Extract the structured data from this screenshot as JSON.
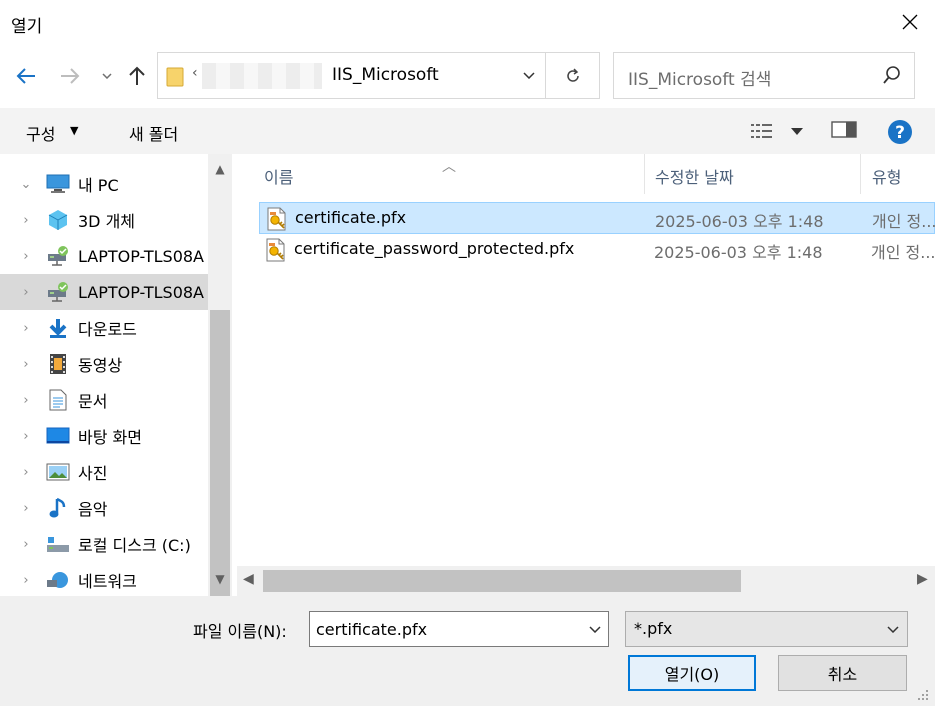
{
  "window": {
    "title": "열기"
  },
  "address": {
    "folder": "IIS_Microsoft",
    "crumb_sep": "‹"
  },
  "search": {
    "placeholder": "IIS_Microsoft 검색"
  },
  "toolbar": {
    "organize": "구성",
    "new_folder": "새 폴더"
  },
  "nav": {
    "items": [
      {
        "label": "내 PC",
        "chev": "⌄",
        "icon": "pc-icon"
      },
      {
        "label": "3D 개체",
        "chev": "›",
        "icon": "3d-objects-icon"
      },
      {
        "label": "LAPTOP-TLS08A",
        "chev": "›",
        "icon": "network-drive-icon"
      },
      {
        "label": "LAPTOP-TLS08A",
        "chev": "›",
        "icon": "network-drive-icon"
      },
      {
        "label": "다운로드",
        "chev": "›",
        "icon": "download-icon"
      },
      {
        "label": "동영상",
        "chev": "›",
        "icon": "video-icon"
      },
      {
        "label": "문서",
        "chev": "›",
        "icon": "document-icon"
      },
      {
        "label": "바탕 화면",
        "chev": "›",
        "icon": "desktop-icon"
      },
      {
        "label": "사진",
        "chev": "›",
        "icon": "pictures-icon"
      },
      {
        "label": "음악",
        "chev": "›",
        "icon": "music-icon"
      },
      {
        "label": "로컬 디스크 (C:)",
        "chev": "›",
        "icon": "local-disk-icon"
      },
      {
        "label": "네트워크",
        "chev": "›",
        "icon": "network-icon"
      }
    ]
  },
  "list": {
    "columns": {
      "name": "이름",
      "modified": "수정한 날짜",
      "type": "유형"
    },
    "files": [
      {
        "name": "certificate.pfx",
        "modified": "2025-06-03 오후 1:48",
        "type": "개인 정..."
      },
      {
        "name": "certificate_password_protected.pfx",
        "modified": "2025-06-03 오후 1:48",
        "type": "개인 정..."
      }
    ]
  },
  "bottom": {
    "filename_label": "파일 이름(N):",
    "filename_value": "certificate.pfx",
    "filetype_value": "*.pfx",
    "open_label": "열기(O)",
    "cancel_label": "취소"
  },
  "colors": {
    "accent": "#0078d7",
    "selection": "#cce8ff",
    "help": "#1a73c6"
  }
}
